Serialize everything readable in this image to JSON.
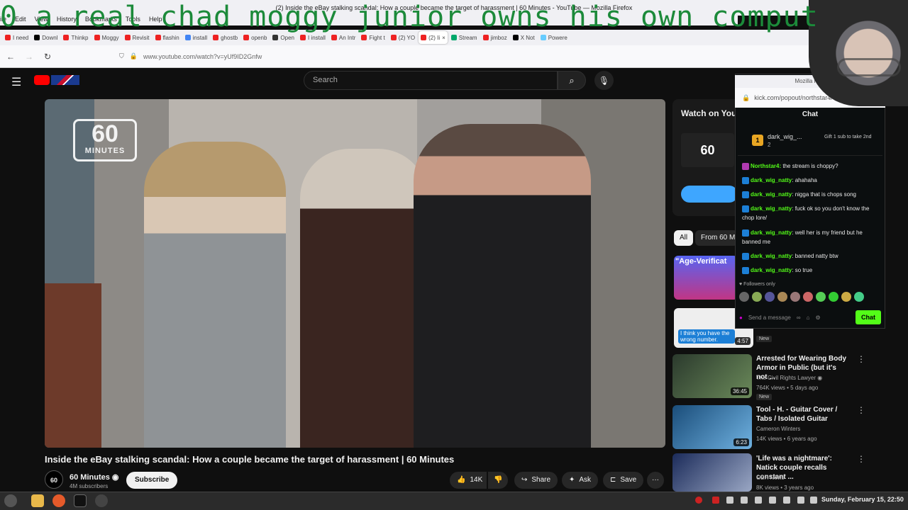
{
  "window": {
    "title": "(2) Inside the eBay stalking scandal: How a couple became the target of harassment | 60 Minutes - YouTube — Mozilla Firefox"
  },
  "overlay": {
    "text": "0 a real chad moggy junior owns his own comput"
  },
  "menu": [
    "ile",
    "Edit",
    "View",
    "History",
    "Bookmarks",
    "Tools",
    "Help"
  ],
  "tabs": [
    "I need",
    "Downl",
    "Thinkp",
    "Moggy",
    "Revisit",
    "flashin",
    "install",
    "ghostb",
    "openb",
    "Open",
    "I install",
    "An Intr",
    "Fight t",
    "(2) YO",
    "(2) Ii",
    "Stream",
    "jimboz",
    "X Not",
    "Powere"
  ],
  "url": "www.youtube.com/watch?v=yUf9ID2Gnfw",
  "yt": {
    "search_placeholder": "Search",
    "video_title": "Inside the eBay stalking scandal: How a couple became the target of harassment | 60 Minutes",
    "logo_text": "60",
    "logo_sub": "MINUTES",
    "channel": {
      "avatar_text": "60",
      "name": "60 Minutes ◉",
      "subs": "4M subscribers",
      "subscribe": "Subscribe"
    },
    "actions": {
      "likes": "14K",
      "share": "Share",
      "ask": "Ask",
      "save": "Save",
      "more": "···"
    },
    "watch_on": "Watch on You",
    "chips": {
      "all": "All",
      "from": "From 60 Mi"
    },
    "recs": [
      {
        "title": "\"Age-Verificat",
        "meta": "",
        "duration": "",
        "tag": ""
      },
      {
        "title": "",
        "meta": "",
        "duration": "4:57",
        "tag": "New",
        "overlay": "I think you have the wrong number."
      },
      {
        "title": "Arrested for Wearing Body Armor in Public (but it's not ...",
        "channel": "The Civil Rights Lawyer ◉",
        "meta": "764K views • 5 days ago",
        "duration": "36:45",
        "tag": "New"
      },
      {
        "title": "Tool - H. - Guitar Cover / Tabs / Isolated Guitar",
        "channel": "Cameron Winters",
        "meta": "14K views • 6 years ago",
        "duration": "6:23",
        "tag": ""
      },
      {
        "title": "'Life was a nightmare': Natick couple recalls constant ...",
        "channel": "GBH News",
        "meta": "8K views • 3 years ago",
        "duration": "",
        "tag": ""
      }
    ]
  },
  "kick": {
    "window_title": "Mozilla Firef",
    "url": "kick.com/popout/northstar4/",
    "header": "Chat",
    "pinned_user": "dark_wig_...",
    "pinned_count": "2",
    "gift_text": "Gift 1 sub to take 2nd",
    "messages": [
      {
        "user": "Northstar4:",
        "text": " the stream is choppy?"
      },
      {
        "user": "dark_wig_natty",
        "text": ": ahahaha"
      },
      {
        "user": "dark_wig_natty",
        "text": ": nigga that is chops song"
      },
      {
        "user": "dark_wig_natty",
        "text": ": fuck ok so you don't know the chop lore/"
      },
      {
        "user": "dark_wig_natty",
        "text": ": well her is my friend but he banned me"
      },
      {
        "user": "dark_wig_natty",
        "text": ": banned natty btw"
      },
      {
        "user": "dark_wig_natty",
        "text": ": so true"
      }
    ],
    "followers_only": "Followers only",
    "send_placeholder": "Send a message",
    "chat_button": "Chat"
  },
  "taskbar": {
    "clock": "Sunday, February 15, 22:50"
  },
  "colors": {
    "yt_red": "#ff0000",
    "kick_green": "#53fc18",
    "overlay_green": "#1c8a3a"
  }
}
